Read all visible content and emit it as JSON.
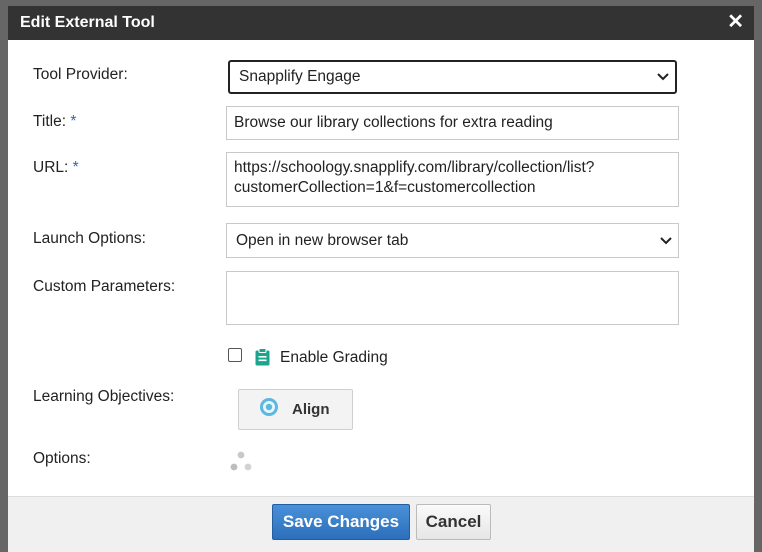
{
  "dialog": {
    "title": "Edit External Tool",
    "close_glyph": "✕"
  },
  "form": {
    "tool_provider": {
      "label": "Tool Provider:",
      "value": "Snapplify Engage"
    },
    "title": {
      "label": "Title:",
      "required_mark": "*",
      "value": "Browse our library collections for extra reading"
    },
    "url": {
      "label": "URL:",
      "required_mark": "*",
      "line1": "https://schoology.snapplify.com/library/collection/list?",
      "line2": "customerCollection=1&f=customercollection"
    },
    "launch_options": {
      "label": "Launch Options:",
      "value": "Open in new browser tab"
    },
    "custom_parameters": {
      "label": "Custom Parameters:",
      "value": ""
    },
    "enable_grading": {
      "label": "Enable Grading",
      "checked": false
    },
    "learning_objectives": {
      "label": "Learning Objectives:",
      "button_label": "Align"
    },
    "options": {
      "label": "Options:"
    }
  },
  "footer": {
    "save_label": "Save Changes",
    "cancel_label": "Cancel"
  },
  "colors": {
    "titlebar": "#333333",
    "required": "#2b6cb0",
    "save_button": "#2c6fba",
    "grading_icon": "#1aa58c"
  },
  "icons": {
    "close": "close-icon",
    "chevron": "chevron-down-icon",
    "grading": "clipboard-icon",
    "align": "target-icon",
    "options": "loading-dots-icon"
  }
}
